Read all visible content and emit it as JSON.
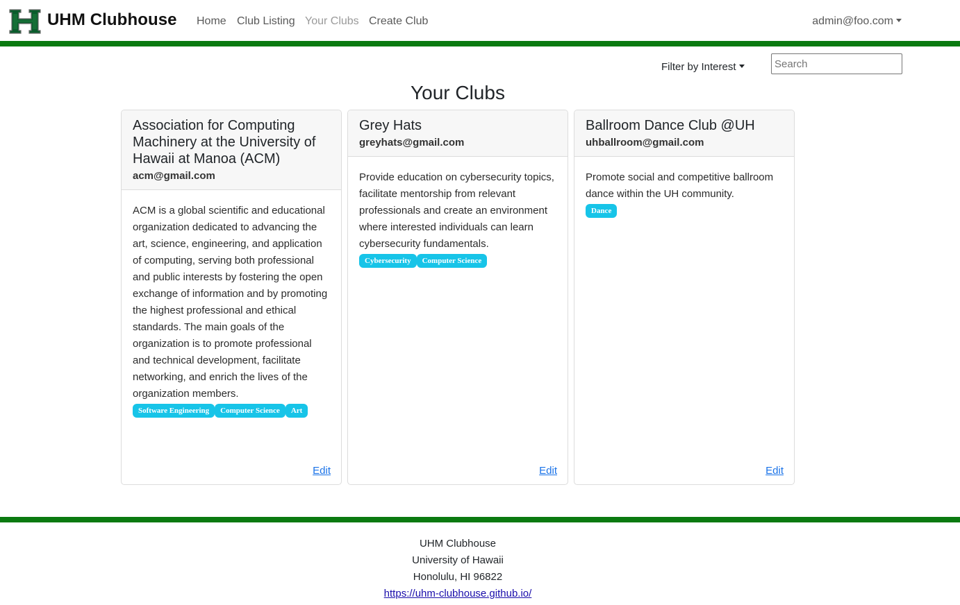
{
  "navbar": {
    "brand": "UHM Clubhouse",
    "links": [
      "Home",
      "Club Listing",
      "Your Clubs",
      "Create Club"
    ],
    "user": "admin@foo.com"
  },
  "filter": {
    "label": "Filter by Interest",
    "search_placeholder": "Search"
  },
  "page_title": "Your Clubs",
  "clubs": [
    {
      "name": "Association for Computing Machinery at the University of Hawaii at Manoa (ACM)",
      "email": "acm@gmail.com",
      "description": "ACM is a global scientific and educational organization dedicated to advancing the art, science, engineering, and application of computing, serving both professional and public interests by fostering the open exchange of information and by promoting the highest professional and ethical standards. The main goals of the organization is to promote professional and technical development, facilitate networking, and enrich the lives of the organization members.",
      "tags": [
        "Software Engineering",
        "Computer Science",
        "Art"
      ],
      "edit": "Edit"
    },
    {
      "name": "Grey Hats",
      "email": "greyhats@gmail.com",
      "description": "Provide education on cybersecurity topics, facilitate mentorship from relevant professionals and create an environment where interested individuals can learn cybersecurity fundamentals.",
      "tags": [
        "Cybersecurity",
        "Computer Science"
      ],
      "edit": "Edit"
    },
    {
      "name": "Ballroom Dance Club @UH",
      "email": "uhballroom@gmail.com",
      "description": "Promote social and competitive ballroom dance within the UH community.",
      "tags": [
        "Dance"
      ],
      "edit": "Edit"
    }
  ],
  "footer": {
    "line1": "UHM Clubhouse",
    "line2": "University of Hawaii",
    "line3": "Honolulu, HI 96822",
    "link": "https://uhm-clubhouse.github.io/"
  },
  "colors": {
    "accent_green": "#0a7a10",
    "tag_blue": "#17c4e8",
    "link_blue": "#1a73e8"
  },
  "icons": {
    "logo": "uh-h-logo-icon",
    "user_menu": "chevron-down-icon",
    "filter": "chevron-down-icon"
  }
}
